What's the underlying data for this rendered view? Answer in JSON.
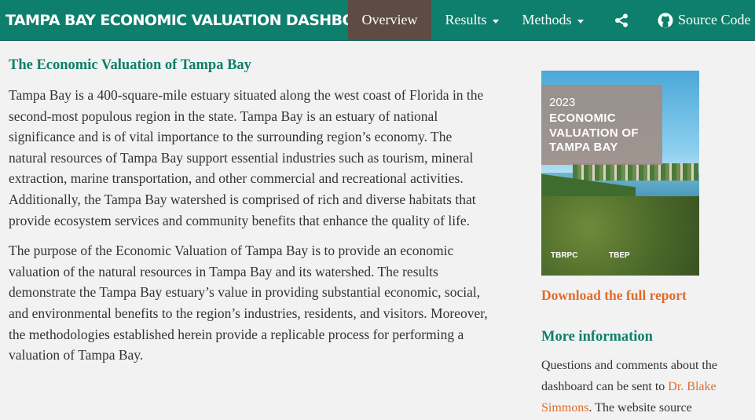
{
  "navbar": {
    "brand": "TAMPA BAY ECONOMIC VALUATION DASHBOARD",
    "overview": "Overview",
    "results": "Results",
    "methods": "Methods",
    "source_code": "Source Code",
    "share_icon": "share-icon",
    "github_icon": "github-icon",
    "color": "#0d7f6c",
    "active_color": "#5e4b43"
  },
  "main": {
    "title": "The Economic Valuation of Tampa Bay",
    "paragraphs": [
      "Tampa Bay is a 400-square-mile estuary situated along the west coast of Florida in the second-most populous region in the state. Tampa Bay is an estuary of national significance and is of vital importance to the surrounding region’s economy. The natural resources of Tampa Bay support essential industries such as tourism, mineral extraction, marine transportation, and other commercial and recreational activities. Additionally, the Tampa Bay watershed is comprised of rich and diverse habitats that provide ecosystem services and community benefits that enhance the quality of life.",
      "The purpose of the Economic Valuation of Tampa Bay is to provide an economic valuation of the natural resources in Tampa Bay and its watershed. The results demonstrate the Tampa Bay estuary’s value in providing substantial economic, social, and environmental benefits to the region’s industries, residents, and visitors. Moreover, the methodologies established herein provide a replicable process for performing a valuation of Tampa Bay."
    ]
  },
  "sidebar": {
    "cover": {
      "year": "2023",
      "title_line1": "ECONOMIC",
      "title_line2": "VALUATION OF",
      "title_line3": "TAMPA BAY",
      "logo1": "TBRPC",
      "logo2": "TBEP"
    },
    "download_label": "Download the full report",
    "more_title": "More information",
    "more_text_before": "Questions and comments about the dashboard can be sent to ",
    "contact_link": "Dr. Blake Simmons",
    "more_text_after": ". The website source",
    "link_color": "#e06c2c"
  }
}
